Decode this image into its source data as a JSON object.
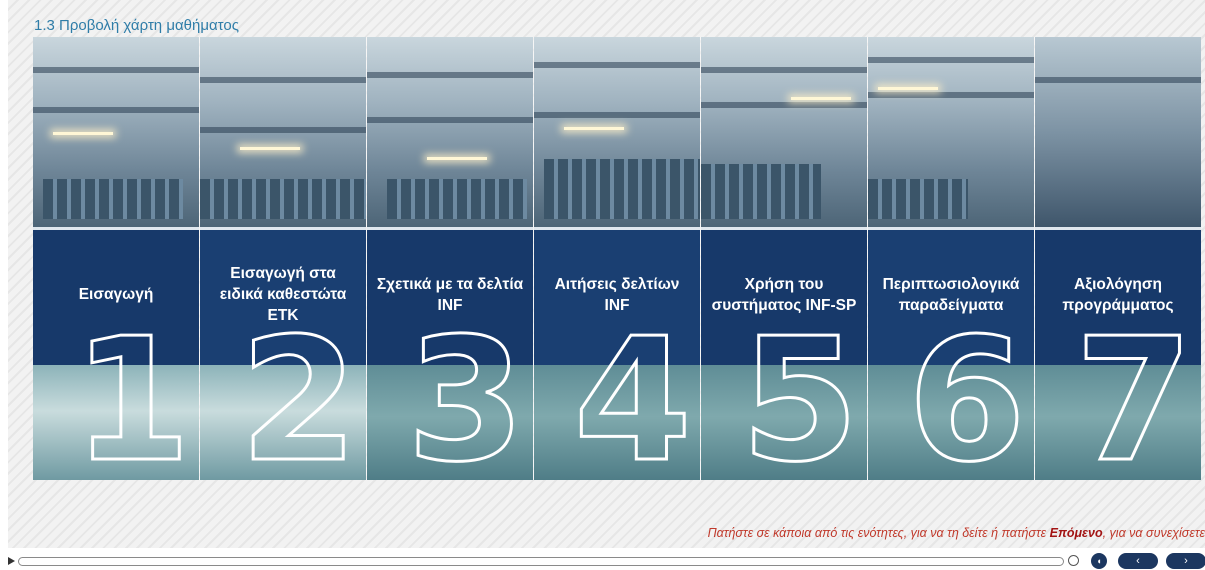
{
  "page_title": "1.3 Προβολή χάρτη μαθήματος",
  "modules": [
    {
      "label": "Εισαγωγή",
      "number": "1"
    },
    {
      "label": "Εισαγωγή στα ειδικά καθεστώτα ΕΤΚ",
      "number": "2"
    },
    {
      "label": "Σχετικά με τα δελτία INF",
      "number": "3"
    },
    {
      "label": "Αιτήσεις δελτίων INF",
      "number": "4"
    },
    {
      "label": "Χρήση του συστήματος INF-SP",
      "number": "5"
    },
    {
      "label": "Περιπτωσιολογικά παραδείγματα",
      "number": "6"
    },
    {
      "label": "Αξιολόγηση προγράμματος",
      "number": "7"
    }
  ],
  "instructions": {
    "before": "Πατήστε σε κάποια από τις ενότητες, για να τη δείτε ή πατήστε ",
    "emphasis": "Επόμενο",
    "after": ", για να συνεχίσετε"
  },
  "controls": {
    "play_icon": "play-icon",
    "search_icon": "search-icon",
    "audio_icon": "audio-icon",
    "prev_label": "‹",
    "next_label": "›"
  },
  "colors": {
    "title": "#2f7da8",
    "panel_band": "#17396a",
    "instruction_text": "#c0392b",
    "nav_button": "#1c3760"
  }
}
